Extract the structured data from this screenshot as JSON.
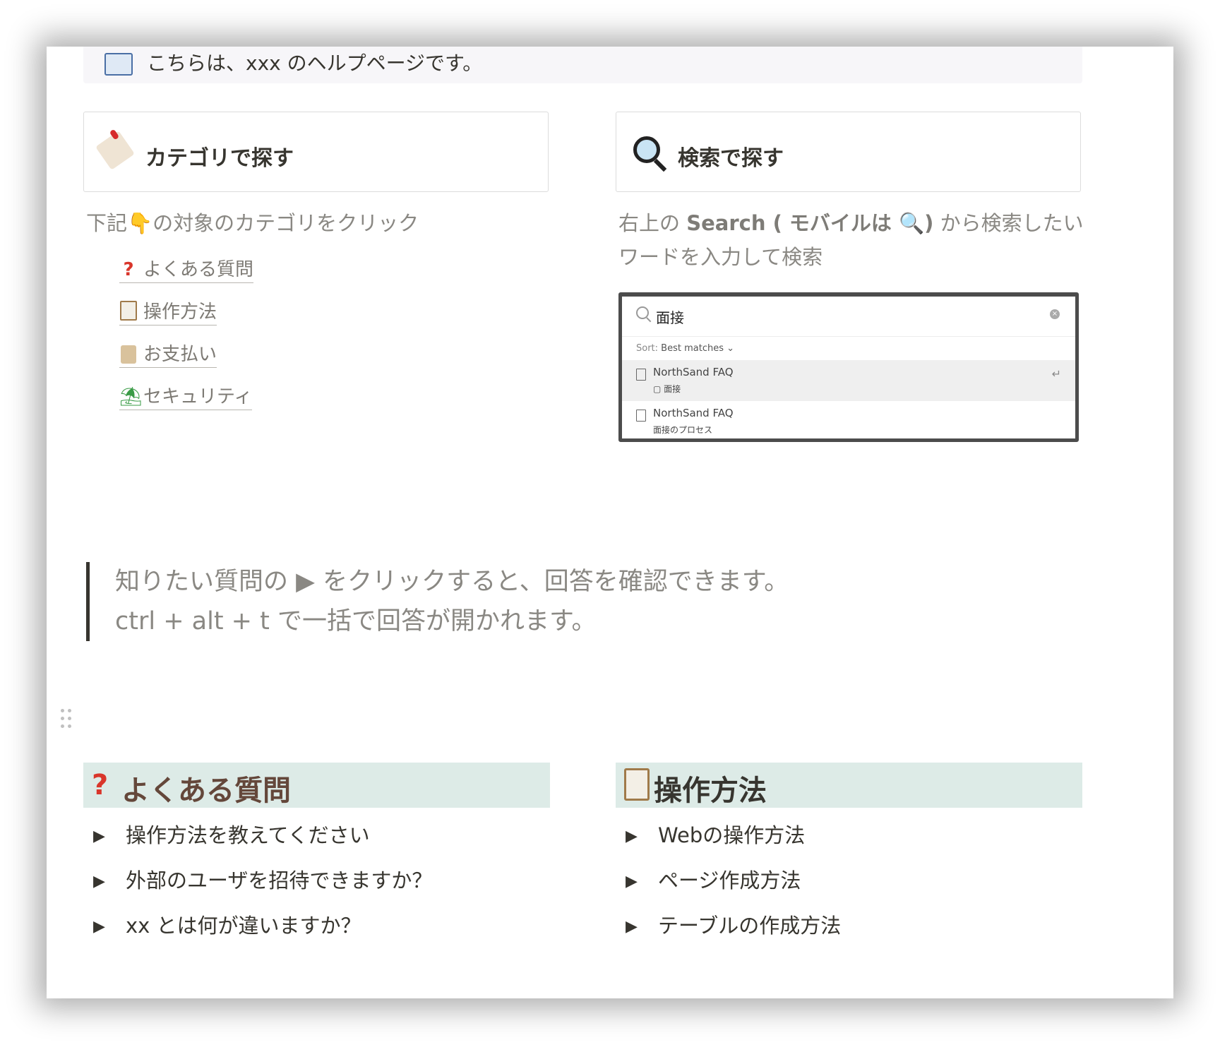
{
  "callout": {
    "text": "こちらは、xxx のヘルプページです。"
  },
  "cards": {
    "category": {
      "title": "カテゴリで探す",
      "icon": "tag-icon"
    },
    "search": {
      "title": "検索で探す",
      "icon": "magnifier-icon"
    }
  },
  "category_desc": {
    "before": "下記",
    "finger": "👇",
    "after": "の対象のカテゴリをクリック"
  },
  "category_links": [
    {
      "icon": "question-mark-icon",
      "label": "よくある質問"
    },
    {
      "icon": "clipboard-icon",
      "label": "操作方法"
    },
    {
      "icon": "scroll-icon",
      "label": "お支払い"
    },
    {
      "icon": "island-icon",
      "label": "セキュリティ"
    }
  ],
  "search_desc": {
    "line1_before": "右上の ",
    "line1_bold": "Search ( モバイルは 🔍)",
    "line1_after": " から検索したい",
    "line2": "ワードを入力して検索"
  },
  "search_shot": {
    "query": "面接",
    "sort_label": "Sort:",
    "sort_value": "Best matches ⌄",
    "results": [
      {
        "title": "NorthSand FAQ",
        "subtitle": "▢ 面接"
      },
      {
        "title": "NorthSand FAQ",
        "subtitle": "面接のプロセス"
      }
    ]
  },
  "quote": {
    "line1": "知りたい質問の ▶ をクリックすると、回答を確認できます。",
    "line2": "ctrl + alt + t で一括で回答が開かれます。"
  },
  "faq": {
    "title": "よくある質問",
    "icon": "question-mark-icon",
    "items": [
      "操作方法を教えてください",
      "外部のユーザを招待できますか？",
      "xx とは何が違いますか？"
    ]
  },
  "howto": {
    "title": "操作方法",
    "icon": "clipboard-icon",
    "items": [
      "Webの操作方法",
      "ページ作成方法",
      "テーブルの作成方法"
    ]
  },
  "toggle_glyph": "▶"
}
